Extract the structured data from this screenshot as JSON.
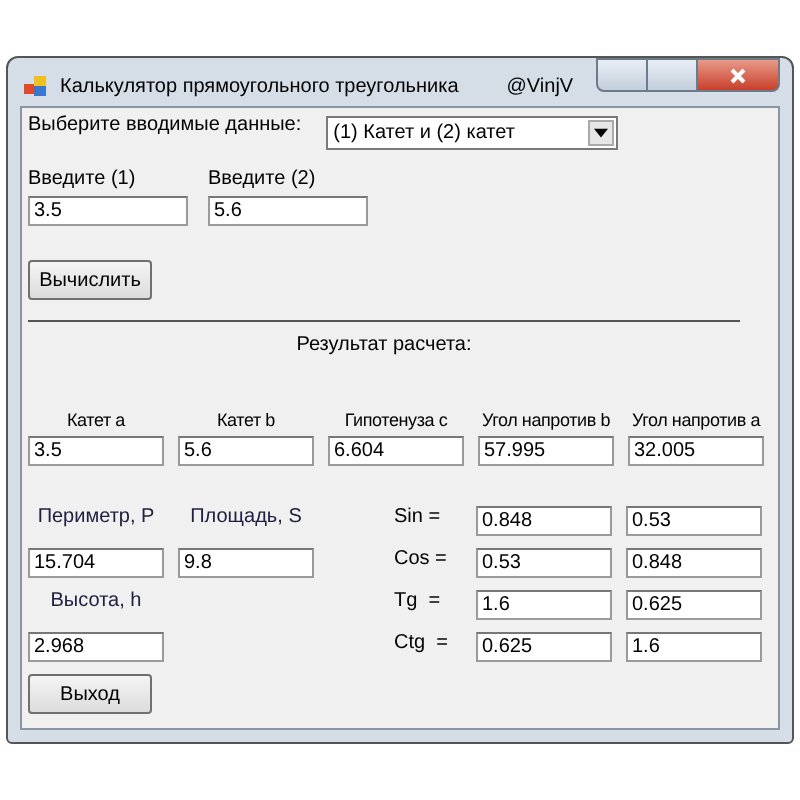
{
  "window": {
    "title": "Калькулятор прямоугольного треугольника",
    "author": "@VinjV"
  },
  "input_select": {
    "label": "Выберите вводимые данные:",
    "value": "(1) Катет и (2) катет"
  },
  "inputs": [
    {
      "label": "Введите (1)",
      "value": "3.5"
    },
    {
      "label": "Введите (2)",
      "value": "5.6"
    }
  ],
  "calculate_button": "Вычислить",
  "result_heading": "Результат расчета:",
  "results": [
    {
      "label": "Катет а",
      "value": "3.5"
    },
    {
      "label": "Катет b",
      "value": "5.6"
    },
    {
      "label": "Гипотенуза c",
      "value": "6.604"
    },
    {
      "label": "Угол напротив b",
      "value": "57.995"
    },
    {
      "label": "Угол напротив а",
      "value": "32.005"
    }
  ],
  "measures": [
    {
      "label": "Периметр, P",
      "value": "15.704"
    },
    {
      "label": "Площадь, S",
      "value": "9.8"
    },
    {
      "label": "Высота, h",
      "value": "2.968"
    }
  ],
  "trig": [
    {
      "label": "Sin =",
      "values": [
        "0.848",
        "0.53"
      ]
    },
    {
      "label": "Cos =",
      "values": [
        "0.53",
        "0.848"
      ]
    },
    {
      "label": "Tg  =",
      "values": [
        "1.6",
        "0.625"
      ]
    },
    {
      "label": "Ctg  =",
      "values": [
        "0.625",
        "1.6"
      ]
    }
  ],
  "exit_button": "Выход"
}
